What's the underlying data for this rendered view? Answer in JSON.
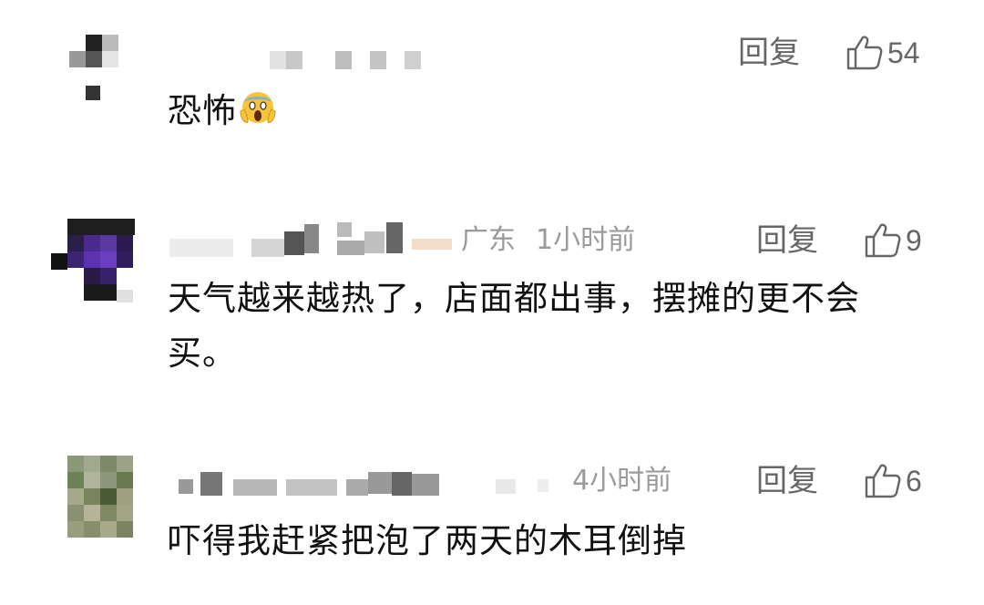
{
  "comments": [
    {
      "time": "",
      "location": "",
      "reply_label": "回复",
      "likes": "54",
      "text": "恐怖",
      "emoji": "scream-emoji"
    },
    {
      "location": "广东",
      "time": "1小时前",
      "reply_label": "回复",
      "likes": "9",
      "text": "天气越来越热了，店面都出事，摆摊的更不会买。"
    },
    {
      "location": "",
      "time": "4小时前",
      "reply_label": "回复",
      "likes": "6",
      "text": "吓得我赶紧把泡了两天的木耳倒掉"
    }
  ],
  "colors": {
    "reply": "#666666",
    "meta": "#9a9a9a",
    "text": "#111111"
  },
  "icons": {
    "like": "thumbs-up-outline-icon"
  }
}
